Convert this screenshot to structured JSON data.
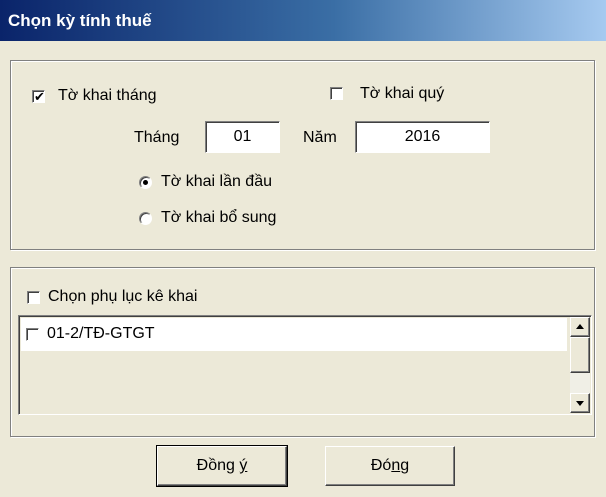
{
  "window": {
    "title": "Chọn kỳ tính thuế"
  },
  "period": {
    "monthly": {
      "label": "Tờ khai tháng",
      "checked": true
    },
    "quarterly": {
      "label": "Tờ khai quý",
      "checked": false
    },
    "month_label": "Tháng",
    "month_value": "01",
    "year_label": "Năm",
    "year_value": "2016",
    "radios": [
      {
        "label": "Tờ khai lần đầu",
        "selected": true
      },
      {
        "label": "Tờ khai bổ sung",
        "selected": false
      }
    ]
  },
  "appendix": {
    "label": "Chọn phụ lục kê khai",
    "checked": false,
    "items": [
      {
        "label": "01-2/TĐ-GTGT",
        "checked": false
      }
    ]
  },
  "buttons": {
    "ok_pre": "Đồng ",
    "ok_key": "ý",
    "ok_post": "",
    "close_pre": "Đó",
    "close_key": "n",
    "close_post": "g"
  }
}
